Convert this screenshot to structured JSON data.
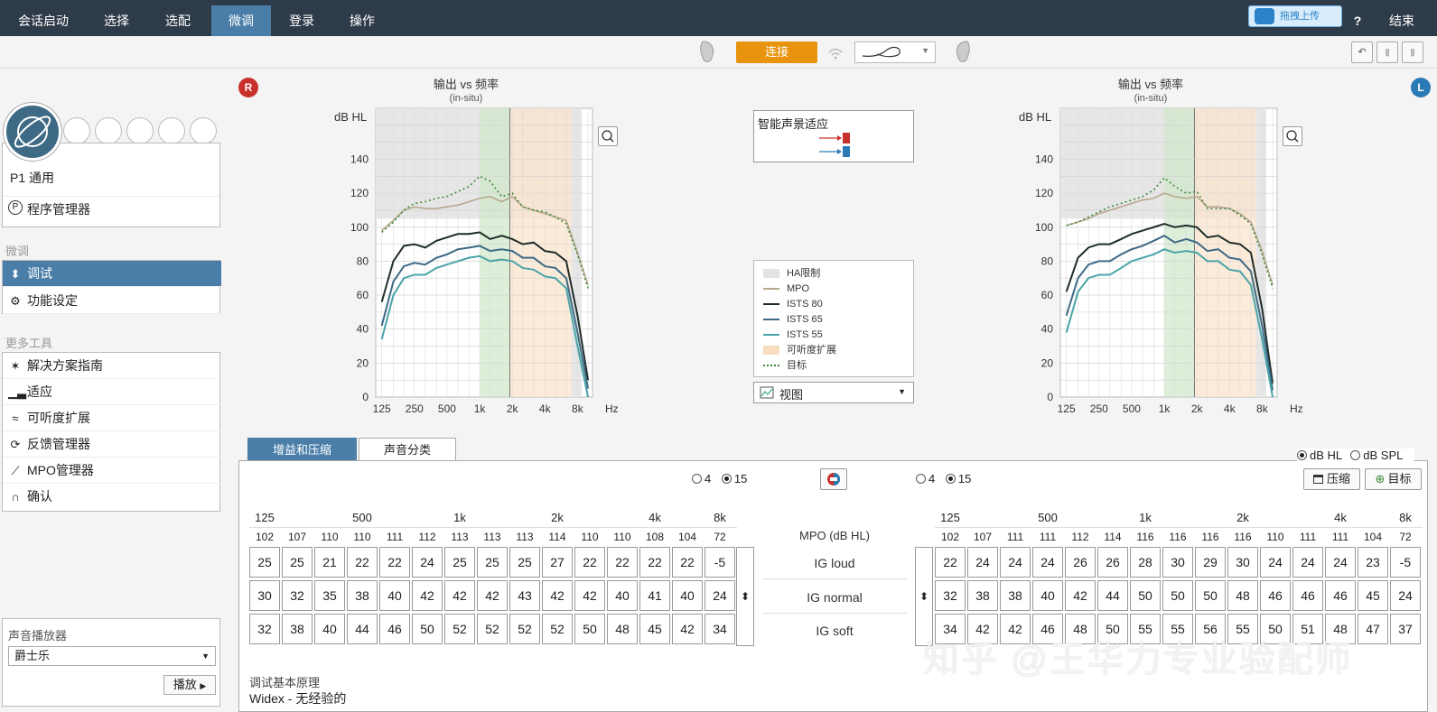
{
  "nav": {
    "tabs": [
      "会话启动",
      "选择",
      "选配",
      "微调",
      "登录",
      "操作"
    ],
    "active_index": 3,
    "upload_label": "拖拽上传",
    "help_label": "?",
    "finish_label": "结束"
  },
  "toolbar": {
    "connect_label": "连接"
  },
  "left": {
    "program_label": "P1  通用",
    "program_manager": "程序管理器",
    "section_finetune": "微调",
    "finetune_items": [
      "调试",
      "功能设定"
    ],
    "section_tools": "更多工具",
    "tool_items": [
      "解决方案指南",
      "适应",
      "可听度扩展",
      "反馈管理器",
      "MPO管理器",
      "确认"
    ],
    "player_title": "声音播放器",
    "player_selected": "爵士乐",
    "play_label": "播放"
  },
  "charts": {
    "title": "输出 vs 频率",
    "subtitle": "(in-situ)",
    "ylabel": "dB HL",
    "xunit": "Hz",
    "right_badge": "R",
    "left_badge": "L",
    "zoom_icon": "magnifier-icon"
  },
  "chart_data": [
    {
      "type": "line",
      "side": "R",
      "title": "输出 vs 频率",
      "subtitle": "(in-situ)",
      "ylabel": "dB HL",
      "xlabel": "Hz",
      "ylim": [
        0,
        170
      ],
      "x_ticks": [
        "125",
        "250",
        "500",
        "1k",
        "2k",
        "4k",
        "8k"
      ],
      "y_ticks": [
        0,
        20,
        40,
        60,
        80,
        100,
        120,
        140
      ],
      "x": [
        125,
        160,
        200,
        250,
        315,
        400,
        500,
        630,
        800,
        1000,
        1250,
        1600,
        2000,
        2500,
        3150,
        4000,
        5000,
        6300,
        8000,
        10000
      ],
      "series": [
        {
          "name": "MPO",
          "values": [
            98,
            104,
            110,
            112,
            111,
            111,
            112,
            113,
            115,
            117,
            118,
            115,
            118,
            112,
            110,
            108,
            106,
            104,
            85,
            66
          ]
        },
        {
          "name": "目标",
          "values": [
            97,
            103,
            110,
            114,
            115,
            117,
            118,
            121,
            124,
            130,
            127,
            118,
            120,
            112,
            110,
            109,
            106,
            102,
            84,
            64
          ]
        },
        {
          "name": "ISTS 80",
          "values": [
            56,
            80,
            89,
            90,
            88,
            92,
            94,
            96,
            96,
            97,
            93,
            95,
            93,
            90,
            91,
            86,
            85,
            80,
            48,
            10
          ]
        },
        {
          "name": "ISTS 65",
          "values": [
            42,
            68,
            77,
            79,
            78,
            82,
            84,
            87,
            88,
            89,
            86,
            87,
            86,
            82,
            82,
            77,
            76,
            70,
            38,
            5
          ]
        },
        {
          "name": "ISTS 55",
          "values": [
            34,
            60,
            70,
            72,
            72,
            76,
            78,
            80,
            82,
            83,
            80,
            81,
            80,
            76,
            75,
            71,
            70,
            64,
            30,
            0
          ]
        }
      ]
    },
    {
      "type": "line",
      "side": "L",
      "title": "输出 vs 频率",
      "subtitle": "(in-situ)",
      "ylabel": "dB HL",
      "xlabel": "Hz",
      "ylim": [
        0,
        170
      ],
      "x_ticks": [
        "125",
        "250",
        "500",
        "1k",
        "2k",
        "4k",
        "8k"
      ],
      "y_ticks": [
        0,
        20,
        40,
        60,
        80,
        100,
        120,
        140
      ],
      "x": [
        125,
        160,
        200,
        250,
        315,
        400,
        500,
        630,
        800,
        1000,
        1250,
        1600,
        2000,
        2500,
        3150,
        4000,
        5000,
        6300,
        8000,
        10000
      ],
      "series": [
        {
          "name": "MPO",
          "values": [
            101,
            103,
            105,
            108,
            110,
            112,
            114,
            116,
            117,
            120,
            118,
            117,
            118,
            112,
            112,
            111,
            108,
            103,
            86,
            66
          ]
        },
        {
          "name": "目标",
          "values": [
            101,
            103,
            106,
            109,
            112,
            114,
            116,
            118,
            122,
            129,
            124,
            120,
            121,
            111,
            111,
            111,
            107,
            102,
            84,
            64
          ]
        },
        {
          "name": "ISTS 80",
          "values": [
            62,
            82,
            88,
            90,
            90,
            93,
            96,
            98,
            100,
            102,
            100,
            101,
            100,
            94,
            95,
            91,
            90,
            85,
            52,
            8
          ]
        },
        {
          "name": "ISTS 65",
          "values": [
            48,
            70,
            78,
            80,
            80,
            84,
            87,
            89,
            92,
            95,
            91,
            93,
            91,
            86,
            87,
            82,
            81,
            74,
            42,
            4
          ]
        },
        {
          "name": "ISTS 55",
          "values": [
            38,
            62,
            70,
            72,
            72,
            76,
            80,
            82,
            84,
            87,
            85,
            86,
            85,
            80,
            80,
            75,
            74,
            66,
            34,
            0
          ]
        }
      ]
    }
  ],
  "smart": {
    "title": "智能声景适应"
  },
  "legend": {
    "items": [
      {
        "label": "HA限制",
        "color": "#e3e3e3",
        "style": "fill"
      },
      {
        "label": "MPO",
        "color": "#b8a890",
        "style": "solid"
      },
      {
        "label": "ISTS 80",
        "color": "#1f2d2a",
        "style": "solid"
      },
      {
        "label": "ISTS 65",
        "color": "#3e6a86",
        "style": "solid"
      },
      {
        "label": "ISTS 55",
        "color": "#4aa4a8",
        "style": "solid"
      },
      {
        "label": "可听度扩展",
        "color": "#f7dcc0",
        "style": "fill"
      },
      {
        "label": "目标",
        "color": "#3f8a3a",
        "style": "dotted"
      }
    ],
    "view_label": "视图"
  },
  "bottom": {
    "tabs": [
      "增益和压缩",
      "声音分类"
    ],
    "unit_options": [
      "dB HL",
      "dB SPL"
    ],
    "unit_selected": 0,
    "channel_options": [
      "4",
      "15"
    ],
    "channel_selected": 1,
    "compress_label": "压缩",
    "target_label": "目标",
    "mpo_label": "MPO (dB HL)",
    "row_labels": [
      "IG loud",
      "IG normal",
      "IG soft"
    ],
    "right": {
      "freq_labels": [
        "125",
        "500",
        "1k",
        "2k",
        "4k",
        "8k"
      ],
      "mpo": [
        "102",
        "107",
        "110",
        "110",
        "111",
        "112",
        "113",
        "113",
        "113",
        "114",
        "110",
        "110",
        "108",
        "104",
        "72"
      ],
      "ig_loud": [
        "25",
        "25",
        "21",
        "22",
        "22",
        "24",
        "25",
        "25",
        "25",
        "27",
        "22",
        "22",
        "22",
        "22",
        "-5"
      ],
      "ig_normal": [
        "30",
        "32",
        "35",
        "38",
        "40",
        "42",
        "42",
        "42",
        "43",
        "42",
        "42",
        "40",
        "41",
        "40",
        "24"
      ],
      "ig_soft": [
        "32",
        "38",
        "40",
        "44",
        "46",
        "50",
        "52",
        "52",
        "52",
        "52",
        "50",
        "48",
        "45",
        "42",
        "34"
      ]
    },
    "left": {
      "freq_labels": [
        "125",
        "500",
        "1k",
        "2k",
        "4k",
        "8k"
      ],
      "mpo": [
        "102",
        "107",
        "111",
        "111",
        "112",
        "114",
        "116",
        "116",
        "116",
        "116",
        "110",
        "111",
        "111",
        "104",
        "72"
      ],
      "ig_loud": [
        "22",
        "24",
        "24",
        "24",
        "26",
        "26",
        "28",
        "30",
        "29",
        "30",
        "24",
        "24",
        "24",
        "23",
        "-5"
      ],
      "ig_normal": [
        "32",
        "38",
        "38",
        "40",
        "42",
        "44",
        "50",
        "50",
        "50",
        "48",
        "46",
        "46",
        "46",
        "45",
        "24"
      ],
      "ig_soft": [
        "34",
        "42",
        "42",
        "46",
        "48",
        "50",
        "55",
        "55",
        "56",
        "55",
        "50",
        "51",
        "48",
        "47",
        "37"
      ]
    },
    "rationale_title": "调试基本原理",
    "rationale_value": "Widex - 无经验的"
  },
  "watermark": "知乎 @王华力专业验配师"
}
